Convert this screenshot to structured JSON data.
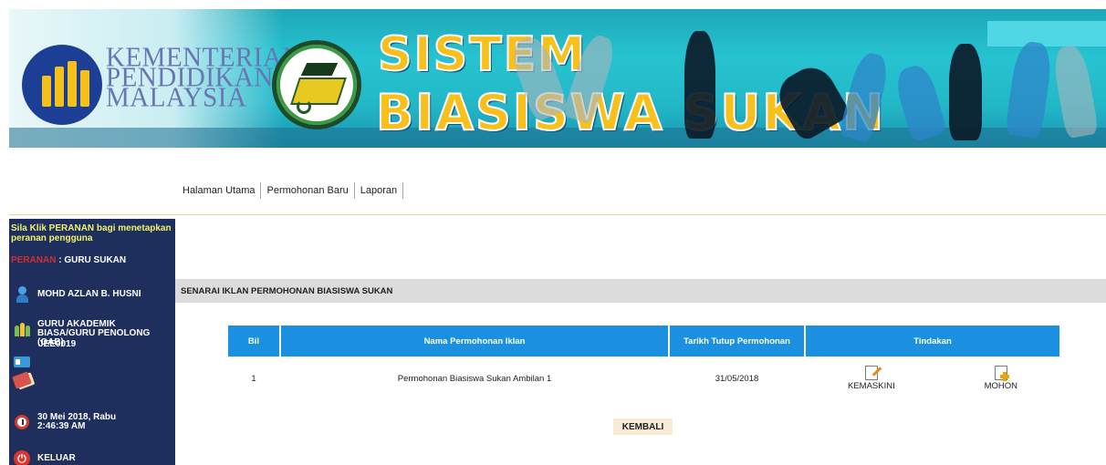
{
  "banner": {
    "ministry_line1": "KEMENTERIAN",
    "ministry_line2": "PENDIDIKAN",
    "ministry_line3": "MALAYSIA",
    "title_line1": "SISTEM",
    "title_line2": "BIASISWA SUKAN"
  },
  "nav": {
    "items": [
      "Halaman Utama",
      "Permohonan Baru",
      "Laporan"
    ]
  },
  "sidebar": {
    "hint": "Sila Klik PERANAN bagi menetapkan peranan pengguna",
    "peranan_key": "PERANAN",
    "peranan_value": " : GURU SUKAN",
    "user_name": "MOHD AZLAN B. HUSNI",
    "position": "GURU AKADEMIK BIASA/GURU PENOLONG (GAB)",
    "school_code": "JEE0019",
    "datetime_line1": "30 Mei 2018, Rabu",
    "datetime_line2": "2:46:39 AM",
    "logout": "KELUAR"
  },
  "main": {
    "section_title": "SENARAI IKLAN PERMOHONAN BIASISWA SUKAN",
    "table": {
      "headers": [
        "Bil",
        "Nama Permohonan Iklan",
        "Tarikh Tutup Permohonan",
        "Tindakan"
      ],
      "rows": [
        {
          "bil": "1",
          "nama": "Permohonan Biasiswa Sukan Ambilan 1",
          "tarikh": "31/05/2018",
          "edit": "KEMASKINI",
          "apply": "MOHON"
        }
      ]
    },
    "back_label": "KEMBALI"
  },
  "colors": {
    "sidebar_bg": "#1e2f5e",
    "table_header": "#1b8fe0",
    "title_yellow": "#f7c01b",
    "hint_yellow": "#f1f26b",
    "peranan_red": "#d32e2e"
  }
}
